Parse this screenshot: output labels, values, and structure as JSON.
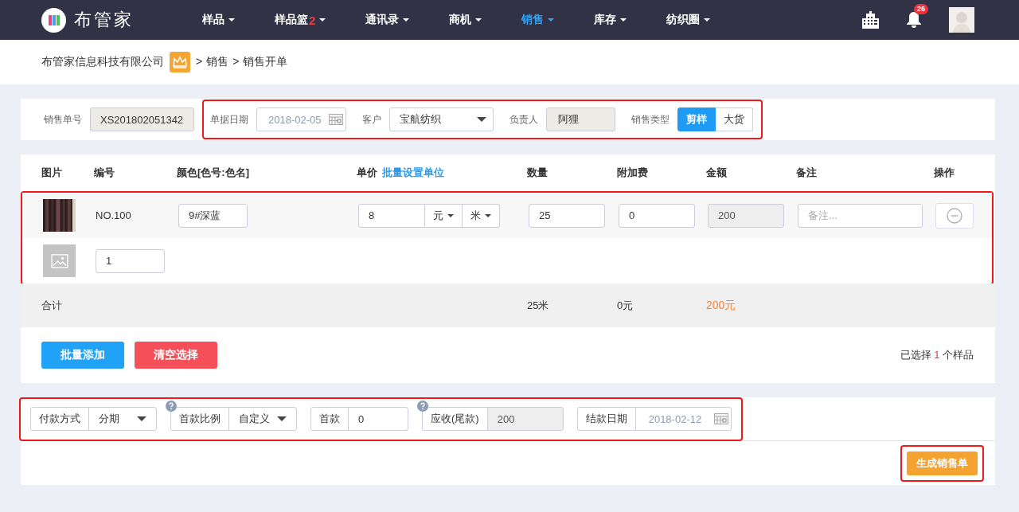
{
  "nav": {
    "brand": "布管家",
    "menu": [
      {
        "label": "样品",
        "selected": false
      },
      {
        "label": "样品篮",
        "badge": "2",
        "selected": false
      },
      {
        "label": "通讯录",
        "selected": false
      },
      {
        "label": "商机",
        "selected": false
      },
      {
        "label": "销售",
        "selected": true
      },
      {
        "label": "库存",
        "selected": false
      },
      {
        "label": "纺织圈",
        "selected": false
      }
    ],
    "notification_count": "26"
  },
  "breadcrumb": {
    "company": "布管家信息科技有限公司",
    "separator": ">",
    "path": [
      "销售",
      "销售开单"
    ]
  },
  "order_header": {
    "order_no": {
      "label": "销售单号",
      "value": "XS201802051342"
    },
    "group": {
      "highlighted": true,
      "date": {
        "label": "单据日期",
        "value": "2018-02-05"
      },
      "customer": {
        "label": "客户",
        "value": "宝航纺织"
      },
      "owner": {
        "label": "负责人",
        "value": "阿狸"
      },
      "sale_type": {
        "label": "销售类型",
        "options": [
          {
            "label": "剪样",
            "selected": true
          },
          {
            "label": "大货",
            "selected": false
          }
        ]
      }
    }
  },
  "table": {
    "columns": [
      {
        "label": "图片"
      },
      {
        "label": "编号"
      },
      {
        "label": "颜色[色号:色名]"
      },
      {
        "label": "单价",
        "link": "批量设置单位"
      },
      {
        "label": "数量"
      },
      {
        "label": "附加费"
      },
      {
        "label": "金额"
      },
      {
        "label": "备注"
      },
      {
        "label": "操作"
      }
    ],
    "rows_highlighted": true,
    "rows": [
      {
        "kind": "item",
        "code": "NO.100",
        "color_code": "9#深蓝",
        "price": "8",
        "currency": "元",
        "unit": "米",
        "quantity": "25",
        "extra_fee": "0",
        "amount": "200",
        "note_placeholder": "备注..."
      },
      {
        "kind": "blank",
        "code_input": "1"
      }
    ],
    "totals": {
      "label": "合计",
      "quantity": "25米",
      "extra_fee": "0元",
      "amount": "200元"
    },
    "buttons": {
      "batch_add": "批量添加",
      "clear": "清空选择"
    },
    "selection": {
      "prefix": "已选择",
      "count": "1",
      "suffix": "个样品"
    }
  },
  "payment": {
    "highlighted": true,
    "fields": [
      {
        "kind": "select",
        "label": "付款方式",
        "value": "分期",
        "help": false
      },
      {
        "kind": "select",
        "label": "首款比例",
        "value": "自定义",
        "help": true
      },
      {
        "kind": "input",
        "label": "首款",
        "value": "0",
        "help": false
      },
      {
        "kind": "readonly",
        "label": "应收(尾款)",
        "value": "200",
        "help": true
      },
      {
        "kind": "date",
        "label": "结款日期",
        "value": "2018-02-12",
        "help": false
      }
    ]
  },
  "submit": {
    "label": "生成销售单",
    "highlighted": true
  }
}
